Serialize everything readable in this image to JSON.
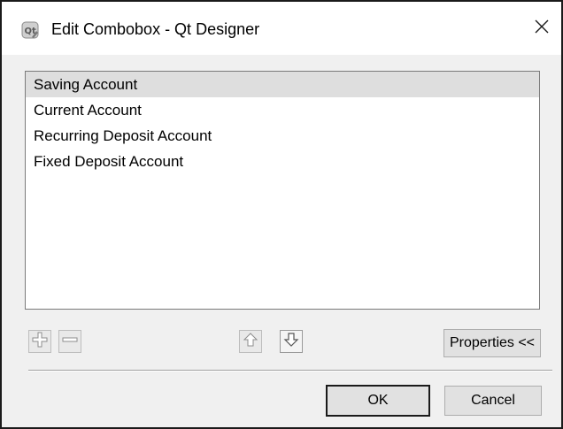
{
  "window": {
    "title": "Edit Combobox - Qt Designer",
    "app_icon": "qt-designer-icon",
    "close_icon": "close-icon"
  },
  "list": {
    "items": [
      {
        "label": "Saving Account",
        "selected": true
      },
      {
        "label": "Current Account",
        "selected": false
      },
      {
        "label": "Recurring Deposit Account",
        "selected": false
      },
      {
        "label": "Fixed Deposit Account",
        "selected": false
      }
    ]
  },
  "toolbar": {
    "add_icon": "plus-icon",
    "remove_icon": "minus-icon",
    "move_up_icon": "arrow-up-icon",
    "move_down_icon": "arrow-down-icon",
    "properties_label": "Properties <<"
  },
  "buttons": {
    "ok_label": "OK",
    "cancel_label": "Cancel"
  },
  "colors": {
    "selection": "#dedede",
    "window_bg": "#f0f0f0",
    "titlebar_bg": "#ffffff"
  }
}
